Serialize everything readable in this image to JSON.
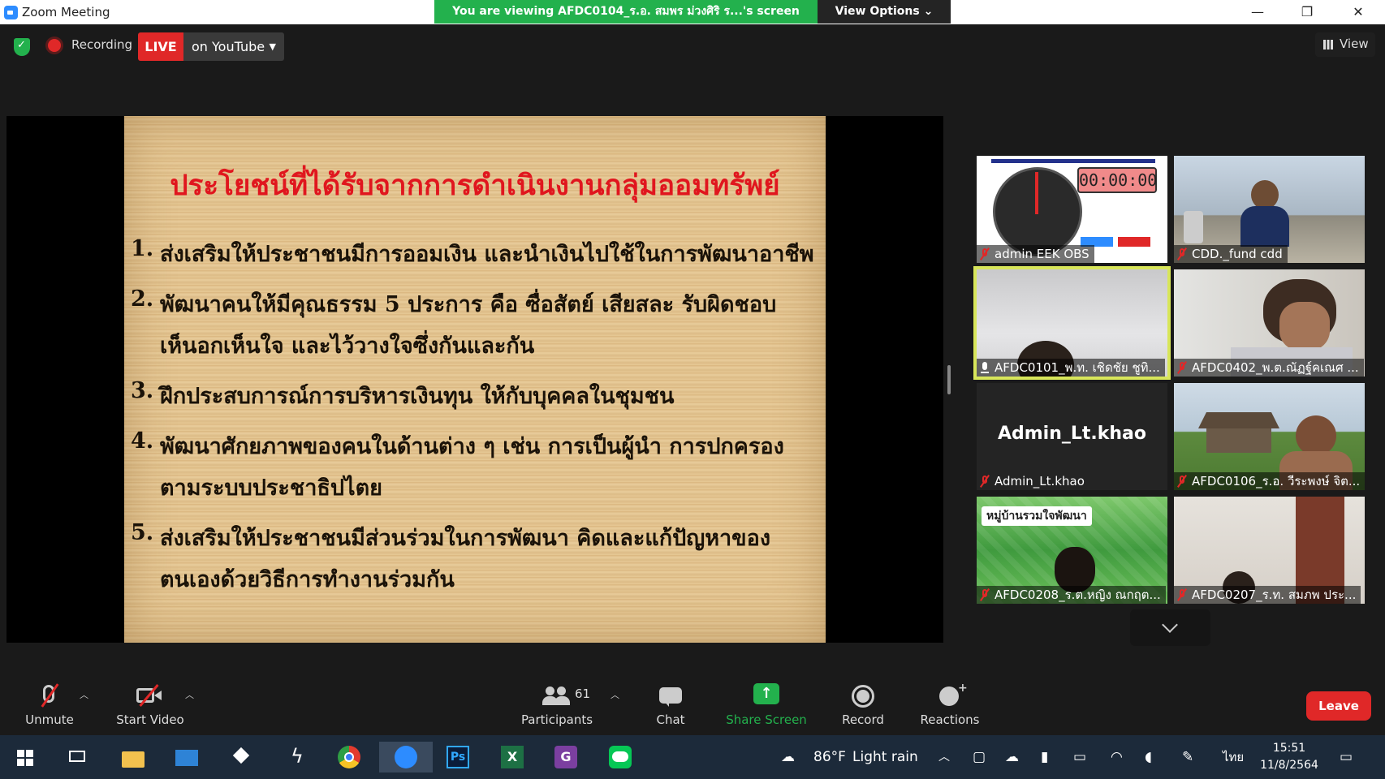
{
  "window": {
    "title": "Zoom Meeting",
    "banner": "You are viewing AFDC0104_ร.อ. สมพร ม่วงศิริ ร...'s screen",
    "view_options": "View Options ⌄",
    "controls": [
      "—",
      "❐",
      "✕"
    ]
  },
  "topbar": {
    "recording_label": "Recording",
    "live_label": "LIVE",
    "live_target": "on YouTube",
    "view_label": "View"
  },
  "slide": {
    "title": "ประโยชน์ที่ได้รับจากการดำเนินงานกลุ่มออมทรัพย์",
    "items": [
      {
        "num": "1.",
        "lines": [
          "ส่งเสริมให้ประชาชนมีการออมเงิน และนำเงินไปใช้ในการพัฒนาอาชีพ"
        ]
      },
      {
        "num": "2.",
        "lines": [
          "พัฒนาคนให้มีคุณธรรม 5 ประการ คือ ซื่อสัตย์ เสียสละ รับผิดชอบ",
          "เห็นอกเห็นใจ และไว้วางใจซึ่งกันและกัน"
        ]
      },
      {
        "num": "3.",
        "lines": [
          "ฝึกประสบการณ์การบริหารเงินทุน ให้กับบุคคลในชุมชน"
        ]
      },
      {
        "num": "4.",
        "lines": [
          "พัฒนาศักยภาพของคนในด้านต่าง ๆ เช่น การเป็นผู้นำ การปกครอง",
          "ตามระบบประชาธิปไตย"
        ]
      },
      {
        "num": "5.",
        "lines": [
          "ส่งเสริมให้ประชาชนมีส่วนร่วมในการพัฒนา คิดและแก้ปัญหาของ",
          "ตนเองด้วยวิธีการทำงานร่วมกัน"
        ]
      }
    ]
  },
  "participants": [
    {
      "name": "admin EEK OBS",
      "muted": true,
      "timer": "00:00:00"
    },
    {
      "name": "CDD._fund cdd",
      "muted": true
    },
    {
      "name": "AFDC0101_พ.ท. เชิดชัย ชูทิ...",
      "muted": false,
      "active": true
    },
    {
      "name": "AFDC0402_พ.ต.ณัฏฐ์คเณศ ...",
      "muted": true
    },
    {
      "name": "Admin_Lt.khao",
      "muted": true,
      "display_name": "Admin_Lt.khao"
    },
    {
      "name": "AFDC0106_ร.อ. วีระพงษ์ จิต...",
      "muted": true
    },
    {
      "name": "AFDC0208_ร.ต.หญิง ณกฤต...",
      "muted": true,
      "overlay_text": "หมู่บ้านรวมใจพัฒนา"
    },
    {
      "name": "AFDC0207_ร.ท. สมภพ ประ...",
      "muted": true
    }
  ],
  "toolbar": {
    "unmute": "Unmute",
    "start_video": "Start Video",
    "participants": "Participants",
    "participants_count": "61",
    "chat": "Chat",
    "share_screen": "Share Screen",
    "record": "Record",
    "reactions": "Reactions",
    "leave": "Leave"
  },
  "taskbar": {
    "weather_temp": "86°F",
    "weather_desc": "Light rain",
    "language": "ไทย",
    "time": "15:51",
    "date": "11/8/2564"
  },
  "colors": {
    "zoom_green": "#23b14d",
    "live_red": "#e02828",
    "active_speaker": "#d8e65a",
    "slide_title": "#e0161e"
  }
}
